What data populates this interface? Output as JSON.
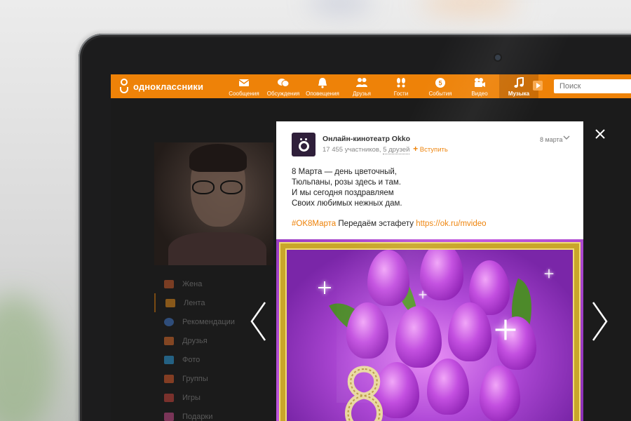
{
  "brand": {
    "name": "одноклассники",
    "accent": "#ee8208"
  },
  "nav": [
    {
      "label": "Сообщения",
      "icon": "envelope-icon"
    },
    {
      "label": "Обсуждения",
      "icon": "chat-bubbles-icon"
    },
    {
      "label": "Оповещения",
      "icon": "bell-icon"
    },
    {
      "label": "Друзья",
      "icon": "friends-icon"
    },
    {
      "label": "Гости",
      "icon": "footprints-icon"
    },
    {
      "label": "События",
      "icon": "events-icon"
    },
    {
      "label": "Видео",
      "icon": "video-camera-icon"
    },
    {
      "label": "Музыка",
      "icon": "music-note-icon",
      "active": true
    }
  ],
  "search": {
    "placeholder": "Поиск"
  },
  "sidebar": [
    {
      "label": "Жена",
      "color": "#c85a2a"
    },
    {
      "label": "Лента",
      "color": "#e28a1a"
    },
    {
      "label": "Рекомендации",
      "color": "#3f77c9"
    },
    {
      "label": "Друзья",
      "color": "#d86a2a"
    },
    {
      "label": "Фото",
      "color": "#2c9ad8"
    },
    {
      "label": "Группы",
      "color": "#d85a2a"
    },
    {
      "label": "Игры",
      "color": "#c8443a"
    },
    {
      "label": "Подарки",
      "color": "#c84a8a"
    }
  ],
  "post": {
    "group_name": "Онлайн-кинотеатр Okko",
    "members": "17 455 участников,",
    "friends": "5 друзей",
    "join_label": "Вступить",
    "date": "8 марта",
    "lines": [
      "8 Марта — день цветочный,",
      "Тюльпаны, розы здесь и там.",
      "И мы сегодня поздравляем",
      "Своих любимых нежных дам."
    ],
    "hashtag": "#OK8Марта",
    "relay_text": "Передаём эстафету",
    "link": "https://ok.ru/mvideo"
  }
}
